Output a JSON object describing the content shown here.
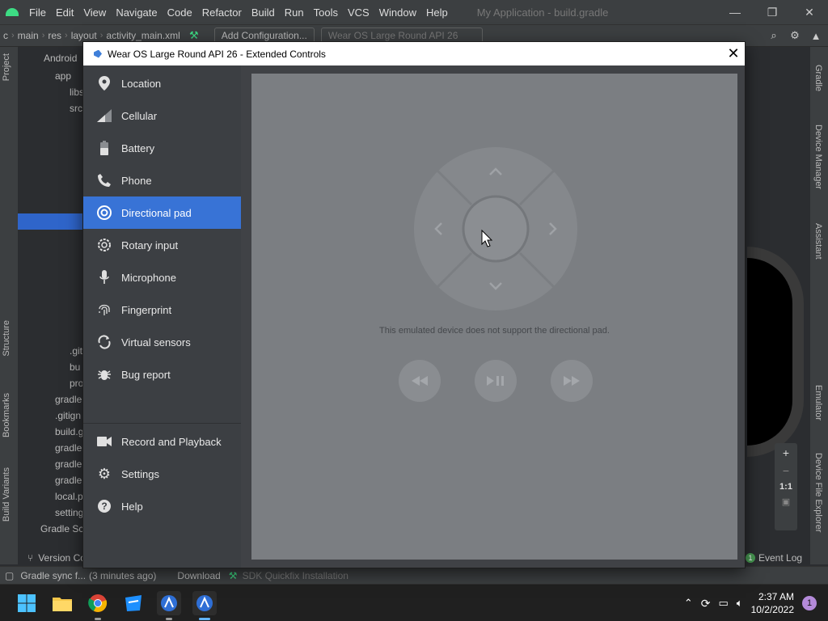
{
  "ide": {
    "menu": [
      "File",
      "Edit",
      "View",
      "Navigate",
      "Code",
      "Refactor",
      "Build",
      "Run",
      "Tools",
      "VCS",
      "Window",
      "Help"
    ],
    "window_title": "My Application - build.gradle",
    "breadcrumbs": [
      "c",
      "main",
      "res",
      "layout",
      "activity_main.xml"
    ],
    "add_config": "Add Configuration...",
    "device_selector": "Wear OS Large Round API 26",
    "project_header": "Android",
    "tree": [
      "app",
      "libs",
      "src",
      ".git",
      "bu",
      "pro",
      "gradle",
      ".gitign",
      "build.g",
      "gradle",
      "gradle",
      "gradle",
      "local.p",
      "setting",
      "Gradle Scri"
    ],
    "left_tabs": [
      "Project",
      "Structure",
      "Bookmarks",
      "Build Variants"
    ],
    "right_tabs": [
      "Gradle",
      "Device Manager",
      "Assistant",
      "Emulator",
      "Device File Explorer"
    ],
    "version_control": "Version Co",
    "event_log": "Event Log",
    "event_count": "1",
    "status": {
      "sync": "Gradle sync f...",
      "sync_time": "(3 minutes ago)",
      "download": "Download",
      "sdk_fix": "SDK Quickfix Installation"
    },
    "zoom": {
      "plus": "+",
      "minus": "−",
      "ratio": "1:1"
    }
  },
  "dialog": {
    "title": "Wear OS Large Round API 26 - Extended Controls",
    "nav": [
      {
        "label": "Location",
        "icon": "location-pin-icon"
      },
      {
        "label": "Cellular",
        "icon": "cellular-signal-icon"
      },
      {
        "label": "Battery",
        "icon": "battery-icon"
      },
      {
        "label": "Phone",
        "icon": "phone-icon"
      },
      {
        "label": "Directional pad",
        "icon": "dpad-icon",
        "selected": true
      },
      {
        "label": "Rotary input",
        "icon": "rotary-icon"
      },
      {
        "label": "Microphone",
        "icon": "microphone-icon"
      },
      {
        "label": "Fingerprint",
        "icon": "fingerprint-icon"
      },
      {
        "label": "Virtual sensors",
        "icon": "rotate-sensor-icon"
      },
      {
        "label": "Bug report",
        "icon": "bug-icon"
      },
      {
        "label": "Record and Playback",
        "icon": "video-camera-icon"
      },
      {
        "label": "Settings",
        "icon": "gear-icon"
      },
      {
        "label": "Help",
        "icon": "help-icon"
      }
    ],
    "dpad_message": "This emulated device does not support the directional pad."
  },
  "taskbar": {
    "time": "2:37 AM",
    "date": "10/2/2022",
    "notifications": "1"
  },
  "colors": {
    "selected_nav": "#3873d6",
    "content_bg": "#7b7e82",
    "sidebar_bg": "#3c3f43"
  }
}
